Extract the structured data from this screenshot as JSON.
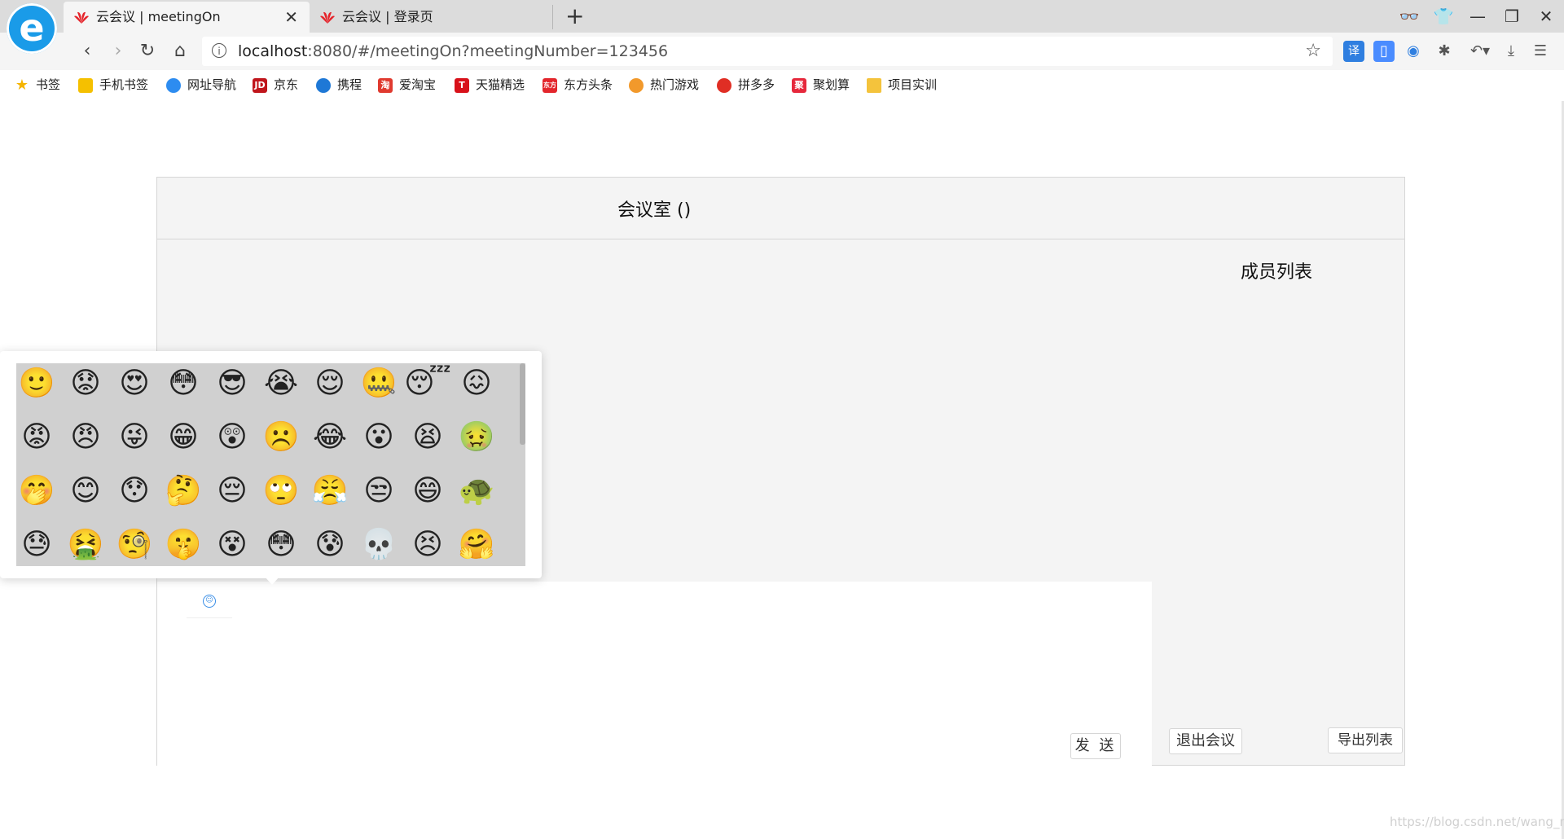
{
  "browser": {
    "tabs": [
      {
        "label": "云会议 | meetingOn",
        "active": true
      },
      {
        "label": "云会议 | 登录页",
        "active": false
      }
    ],
    "new_tab_icon": "plus-icon",
    "url_host": "localhost",
    "url_rest": ":8080/#/meetingOn?meetingNumber=123456",
    "bookmarks": [
      "书签",
      "手机书签",
      "网址导航",
      "京东",
      "携程",
      "爱淘宝",
      "天猫精选",
      "东方头条",
      "热门游戏",
      "拼多多",
      "聚划算",
      "项目实训"
    ],
    "bookmark_icon_text": {
      "jd": "JD",
      "tmall": "T",
      "toutiao": "东方",
      "juhuasuan": "聚",
      "taobao": "淘"
    }
  },
  "page": {
    "room_title": "会议室 ()",
    "members_title": "成员列表",
    "send_label": "发 送",
    "exit_label": "退出会议",
    "export_label": "导出列表",
    "watermark": "https://blog.csdn.net/wang_ra"
  },
  "emoji": [
    "🙂",
    "😟",
    "😍",
    "😳",
    "😎",
    "😭",
    "😌",
    "🤐",
    "😴",
    "😖",
    "😡",
    "😠",
    "😜",
    "😁",
    "😲",
    "☹️",
    "😂",
    "😮",
    "😫",
    "🤢",
    "🤭",
    "😊",
    "😯",
    "🤔",
    "😔",
    "🙄",
    "😤",
    "😒",
    "😄",
    "🐢",
    "😓",
    "🤮",
    "🧐",
    "🤫",
    "😵",
    "😳",
    "😰",
    "💀",
    "😣",
    "🤗"
  ],
  "colors": {
    "accent": "#3a8ee6",
    "browser_blue": "#1a9be8",
    "huawei_red": "#e5232a"
  }
}
